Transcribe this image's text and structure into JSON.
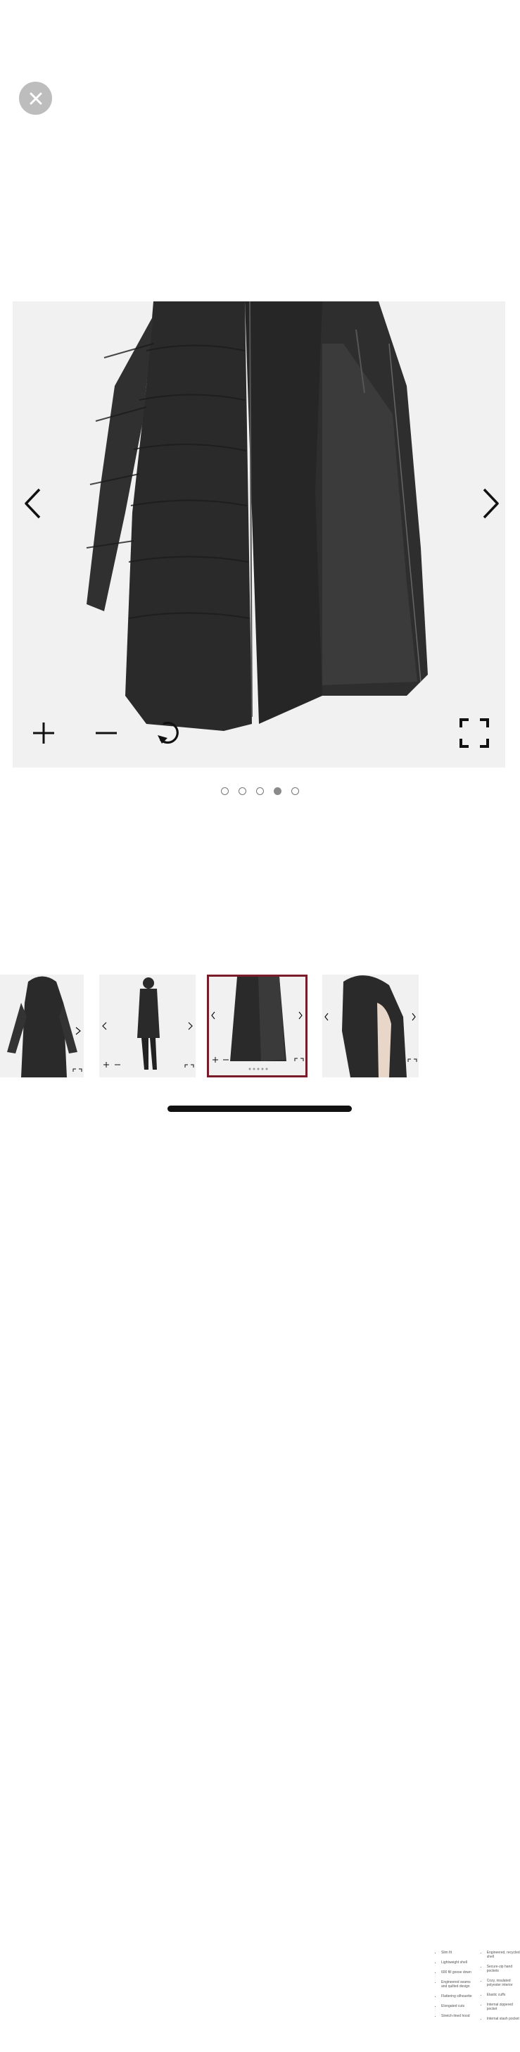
{
  "viewer": {
    "close_icon": "close-icon",
    "prev_icon": "chevron-left-icon",
    "next_icon": "chevron-right-icon",
    "tools": [
      "zoom-in-icon",
      "zoom-out-icon",
      "reset-rotate-icon",
      "fullscreen-icon"
    ],
    "image_count": 5,
    "active_index": 4
  },
  "thumbnails": [
    {
      "name": "thumb-back-view",
      "selected": false
    },
    {
      "name": "thumb-side-view",
      "selected": false
    },
    {
      "name": "thumb-open-jacket",
      "selected": true
    },
    {
      "name": "thumb-hood-detail",
      "selected": false
    },
    {
      "name": "thumb-spec-sheet",
      "selected": false
    }
  ],
  "spec_sheet": {
    "col1": [
      "Slim fit",
      "Lightweight shell",
      "600 fill goose down",
      "Engineered seams and quilted design",
      "Flattering silhouette",
      "Elongated cuts",
      "Stretch-lined hood"
    ],
    "col2": [
      "Engineered, recycled shell",
      "Secure-zip hand pockets",
      "Cozy, insulated polyester interior",
      "Elastic cuffs",
      "Internal zippered pocket",
      "Internal stash pocket"
    ]
  },
  "colors": {
    "accent": "#7a1b2a",
    "jacket": "#2b2b2b",
    "background": "#f1f1f1",
    "close_button": "#bdbdbd"
  }
}
